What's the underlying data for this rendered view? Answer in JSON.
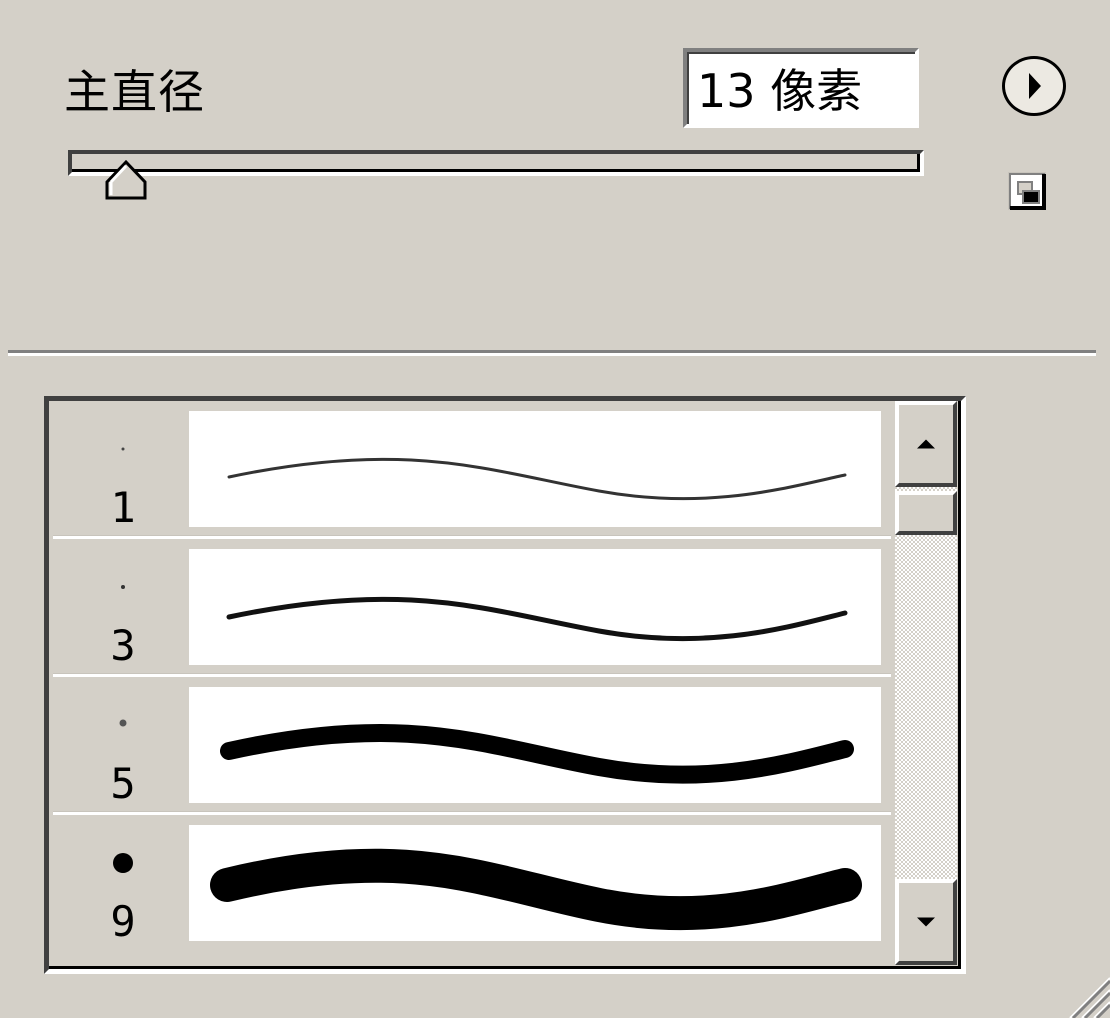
{
  "panel": {
    "diameter_label": "主直径",
    "diameter_value": "13 像素"
  },
  "slider": {
    "value_fraction": 0.06
  },
  "brushes": [
    {
      "size": "1"
    },
    {
      "size": "3"
    },
    {
      "size": "5"
    },
    {
      "size": "9"
    }
  ],
  "icons": {
    "menu": "flyout-menu-arrow-icon",
    "new_preset": "new-brush-preset-icon",
    "scroll_up": "triangle-up-icon",
    "scroll_down": "triangle-down-icon",
    "resize": "resize-grip-icon"
  }
}
